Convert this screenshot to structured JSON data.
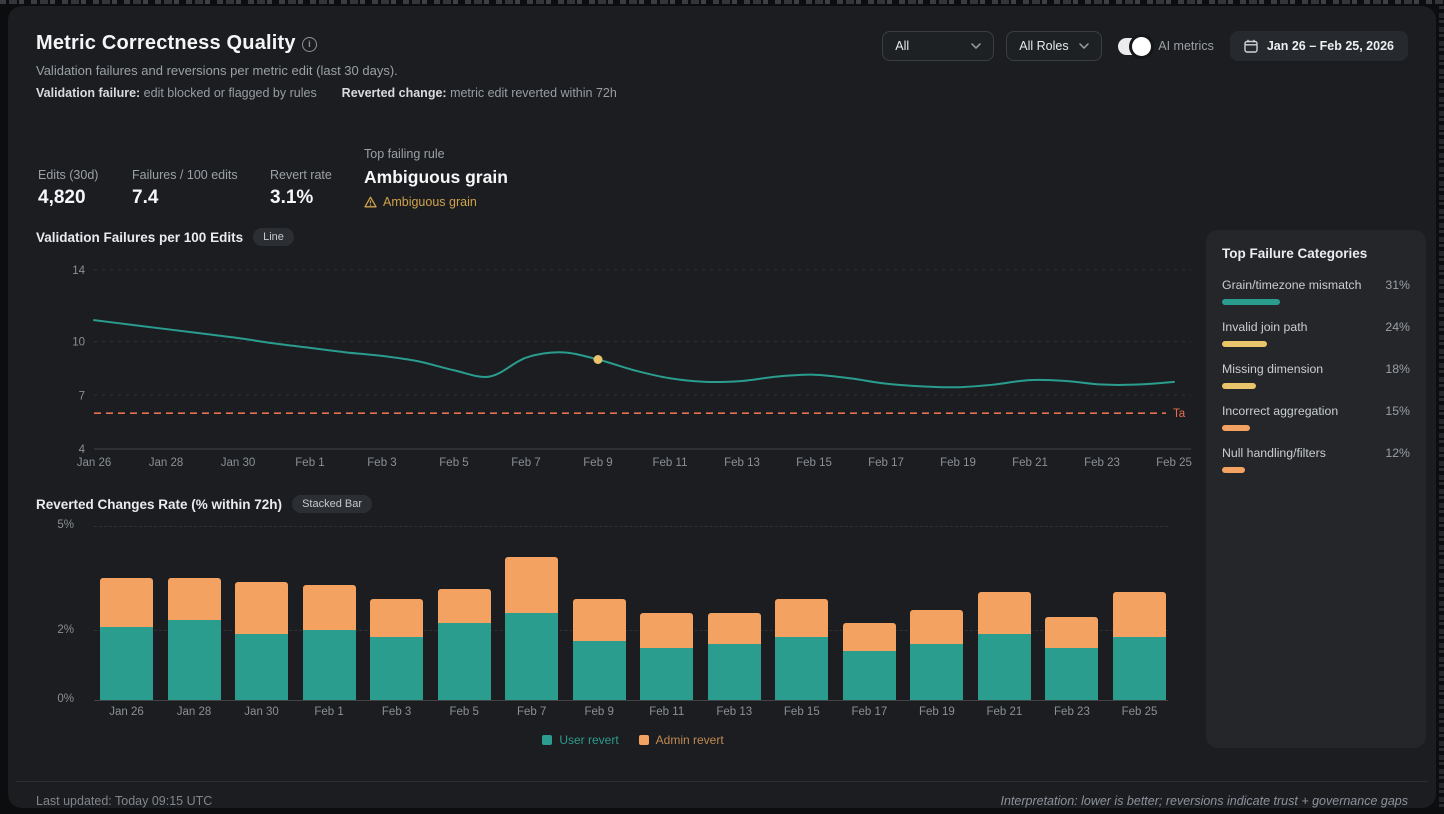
{
  "header": {
    "title": "Metric Correctness Quality",
    "subtitle": "Validation failures and reversions per metric edit (last 30 days).",
    "definitions": [
      {
        "term": "Validation failure:",
        "text": "edit blocked or flagged by rules"
      },
      {
        "term": "Reverted change:",
        "text": "metric edit reverted within 72h"
      }
    ],
    "controls": {
      "filter_all": "All",
      "filter_roles": "All Roles",
      "toggle_label": "AI metrics",
      "toggle_on": true,
      "date_range": "Jan 26 – Feb 25, 2026"
    }
  },
  "kpis": [
    {
      "label": "Edits (30d)",
      "value": "4,820"
    },
    {
      "label": "Failures / 100 edits",
      "value": "7.4"
    },
    {
      "label": "Revert rate",
      "value": "3.1%"
    }
  ],
  "top_failing_rule": {
    "label": "Top failing rule",
    "value": "Ambiguous grain",
    "warning_text": "Ambiguous grain",
    "warning_color": "#cfa24b"
  },
  "failure_categories": {
    "title": "Top Failure Categories",
    "items": [
      {
        "label": "Grain/timezone mismatch",
        "pct": 31,
        "color": "#2a9d8f"
      },
      {
        "label": "Invalid join path",
        "pct": 24,
        "color": "#e9c46a"
      },
      {
        "label": "Missing dimension",
        "pct": 18,
        "color": "#e9c46a"
      },
      {
        "label": "Incorrect aggregation",
        "pct": 15,
        "color": "#f4a261"
      },
      {
        "label": "Null handling/filters",
        "pct": 12,
        "color": "#f4a261"
      }
    ]
  },
  "chart_data": [
    {
      "type": "line",
      "title": "Validation Failures per 100 Edits",
      "badge": "Line",
      "x": [
        "Jan 26",
        "Jan 27",
        "Jan 28",
        "Jan 29",
        "Jan 30",
        "Jan 31",
        "Feb 1",
        "Feb 2",
        "Feb 3",
        "Feb 4",
        "Feb 5",
        "Feb 6",
        "Feb 7",
        "Feb 8",
        "Feb 9",
        "Feb 10",
        "Feb 11",
        "Feb 12",
        "Feb 13",
        "Feb 14",
        "Feb 15",
        "Feb 16",
        "Feb 17",
        "Feb 18",
        "Feb 19",
        "Feb 20",
        "Feb 21",
        "Feb 22",
        "Feb 23",
        "Feb 24",
        "Feb 25"
      ],
      "values": [
        11.2,
        10.95,
        10.7,
        10.45,
        10.2,
        9.9,
        9.65,
        9.4,
        9.2,
        8.9,
        8.4,
        8.05,
        9.1,
        9.4,
        9.0,
        8.4,
        7.95,
        7.75,
        7.8,
        8.05,
        8.15,
        7.95,
        7.65,
        7.5,
        7.45,
        7.6,
        7.85,
        7.8,
        7.6,
        7.6,
        7.75
      ],
      "tick_labels": [
        "Jan 26",
        "Jan 28",
        "Jan 30",
        "Feb 1",
        "Feb 3",
        "Feb 5",
        "Feb 7",
        "Feb 9",
        "Feb 11",
        "Feb 13",
        "Feb 15",
        "Feb 17",
        "Feb 19",
        "Feb 21",
        "Feb 23",
        "Feb 25"
      ],
      "yticks": [
        14,
        10,
        7,
        4
      ],
      "ylim": [
        4,
        14
      ],
      "grid": "dashed horizontal",
      "line_color": "#2a9d8f",
      "highlight_point": {
        "x": "Feb 9",
        "value": 9.0,
        "color": "#e9c46a"
      },
      "target_line": {
        "value": 6,
        "color": "#e76f51",
        "visible_label": "Ta"
      }
    },
    {
      "type": "stacked_bar",
      "title": "Reverted Changes Rate (% within 72h)",
      "badge": "Stacked Bar",
      "categories": [
        "Jan 26",
        "Jan 28",
        "Jan 30",
        "Feb 1",
        "Feb 3",
        "Feb 5",
        "Feb 7",
        "Feb 9",
        "Feb 11",
        "Feb 13",
        "Feb 15",
        "Feb 17",
        "Feb 19",
        "Feb 21",
        "Feb 23",
        "Feb 25"
      ],
      "series": [
        {
          "name": "User revert",
          "color": "#2a9d8f",
          "values": [
            2.1,
            2.3,
            1.9,
            2.0,
            1.8,
            2.2,
            2.5,
            1.7,
            1.5,
            1.6,
            1.8,
            1.4,
            1.6,
            1.9,
            1.5,
            1.8
          ]
        },
        {
          "name": "Admin revert",
          "color": "#f4a261",
          "values": [
            1.4,
            1.2,
            1.5,
            1.3,
            1.1,
            1.0,
            1.6,
            1.2,
            1.0,
            0.9,
            1.1,
            0.8,
            1.0,
            1.2,
            0.9,
            1.3
          ]
        }
      ],
      "yticks": [
        "0%",
        "2%",
        "5%"
      ],
      "ylim": [
        0,
        5
      ],
      "grid": "dashed horizontal",
      "legend": [
        "User revert",
        "Admin revert"
      ],
      "legend_position": "bottom center"
    }
  ],
  "footer": {
    "last_updated": "Last updated: Today 09:15 UTC",
    "interpretation": "Interpretation: lower is better; reversions indicate trust + governance gaps"
  }
}
